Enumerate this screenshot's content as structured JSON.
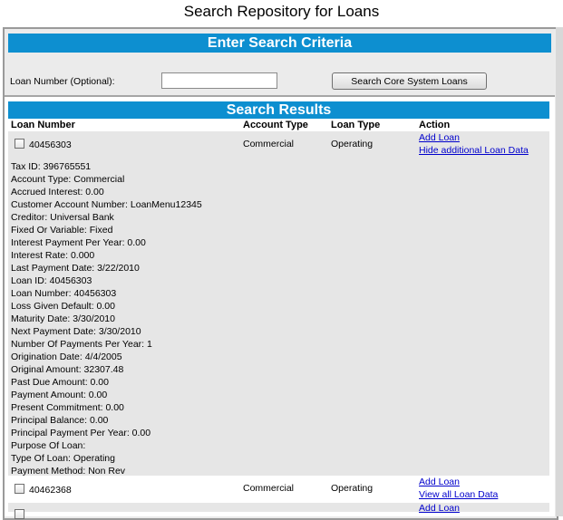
{
  "page": {
    "title": "Search Repository for Loans"
  },
  "criteria": {
    "header": "Enter Search Criteria",
    "loan_number_label": "Loan Number (Optional):",
    "loan_number_value": "",
    "search_button": "Search Core System Loans"
  },
  "results": {
    "header": "Search Results",
    "columns": {
      "loan_number": "Loan Number",
      "account_type": "Account Type",
      "loan_type": "Loan Type",
      "action": "Action"
    },
    "rows": [
      {
        "loan_number": "40456303",
        "account_type": "Commercial",
        "loan_type": "Operating",
        "action_add": "Add Loan",
        "action_toggle": "Hide additional Loan Data",
        "details": [
          "Tax ID: 396765551",
          "Account Type: Commercial",
          "Accrued Interest: 0.00",
          "Customer Account Number: LoanMenu12345",
          "Creditor: Universal Bank",
          "Fixed Or Variable: Fixed",
          "Interest Payment Per Year: 0.00",
          "Interest Rate: 0.000",
          "Last Payment Date: 3/22/2010",
          "Loan ID: 40456303",
          "Loan Number: 40456303",
          "Loss Given Default: 0.00",
          "Maturity Date: 3/30/2010",
          "Next Payment Date: 3/30/2010",
          "Number Of Payments Per Year: 1",
          "Origination Date: 4/4/2005",
          "Original Amount: 32307.48",
          "Past Due Amount: 0.00",
          "Payment Amount: 0.00",
          "Present Commitment: 0.00",
          "Principal Balance: 0.00",
          "Principal Payment Per Year: 0.00",
          "Purpose Of Loan:",
          "Type Of Loan: Operating",
          "Payment Method: Non Rev"
        ]
      },
      {
        "loan_number": "40462368",
        "account_type": "Commercial",
        "loan_type": "Operating",
        "action_add": "Add Loan",
        "action_toggle": "View all Loan Data"
      },
      {
        "action_add": "Add Loan"
      }
    ]
  }
}
